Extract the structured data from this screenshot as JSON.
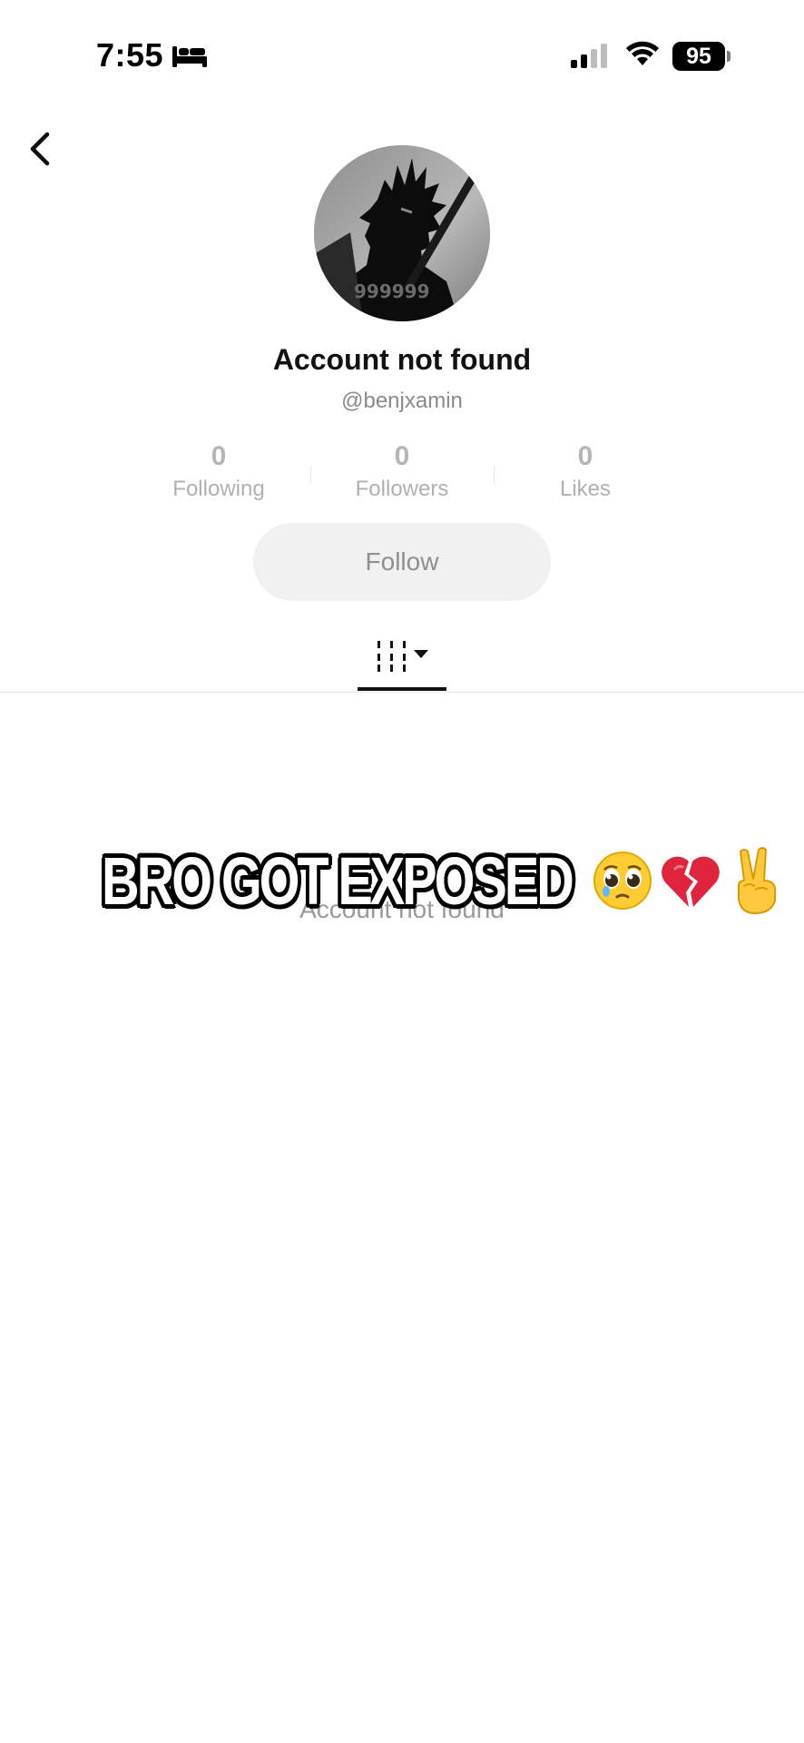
{
  "status_bar": {
    "time": "7:55",
    "battery": "95",
    "icons": [
      "sleep-icon",
      "signal-icon",
      "wifi-icon"
    ]
  },
  "nav": {
    "back_icon": "chevron-left-icon"
  },
  "profile": {
    "title": "Account not found",
    "username": "@benjxamin",
    "avatar_text": "999999"
  },
  "stats": [
    {
      "value": "0",
      "label": "Following"
    },
    {
      "value": "0",
      "label": "Followers"
    },
    {
      "value": "0",
      "label": "Likes"
    }
  ],
  "follow_label": "Follow",
  "tabs": {
    "grid_icon": "grid-icon",
    "dropdown_icon": "caret-down-icon"
  },
  "empty_state": "Account not found",
  "caption": {
    "text": "BRO GOT EXPOSED",
    "emojis": [
      "pleading-face-icon",
      "broken-heart-icon",
      "victory-hand-icon"
    ]
  },
  "colors": {
    "follow_bg": "#f1f1f1",
    "muted_text": "#8a8a8a",
    "accent": "#111111"
  }
}
